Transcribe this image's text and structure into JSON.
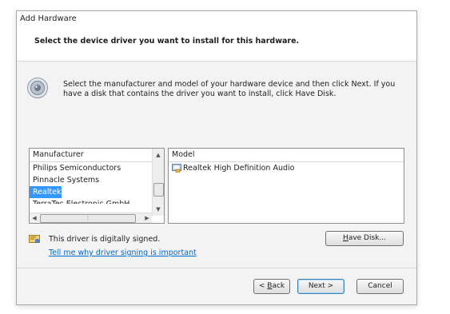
{
  "window": {
    "title": "Add Hardware"
  },
  "banner": {
    "title": "Select the device driver you want to install for this hardware."
  },
  "instructions": "Select the manufacturer and model of your hardware device and then click Next. If you have a disk that contains the driver you want to install, click Have Disk.",
  "manufacturer_list": {
    "header": "Manufacturer",
    "items": [
      "Philips Semiconductors",
      "Pinnacle Systems",
      "Realtek",
      "TerraTec Electronic GmbH"
    ],
    "selected": "Realtek"
  },
  "model_list": {
    "header": "Model",
    "items": [
      "Realtek High Definition Audio"
    ]
  },
  "signing": {
    "status": "This driver is digitally signed.",
    "link": "Tell me why driver signing is important"
  },
  "buttons": {
    "have_disk": {
      "mnemonic": "H",
      "rest": "ave Disk..."
    },
    "back": {
      "prefix": "< ",
      "mnemonic": "B",
      "rest": "ack"
    },
    "next": "Next >",
    "cancel": "Cancel"
  },
  "icons": [
    "speaker-icon",
    "driver-package-icon",
    "signed-driver-icon"
  ],
  "colors": {
    "selection": "#3399ff",
    "link": "#0066cc",
    "window_bg": "#f3f3f3"
  }
}
